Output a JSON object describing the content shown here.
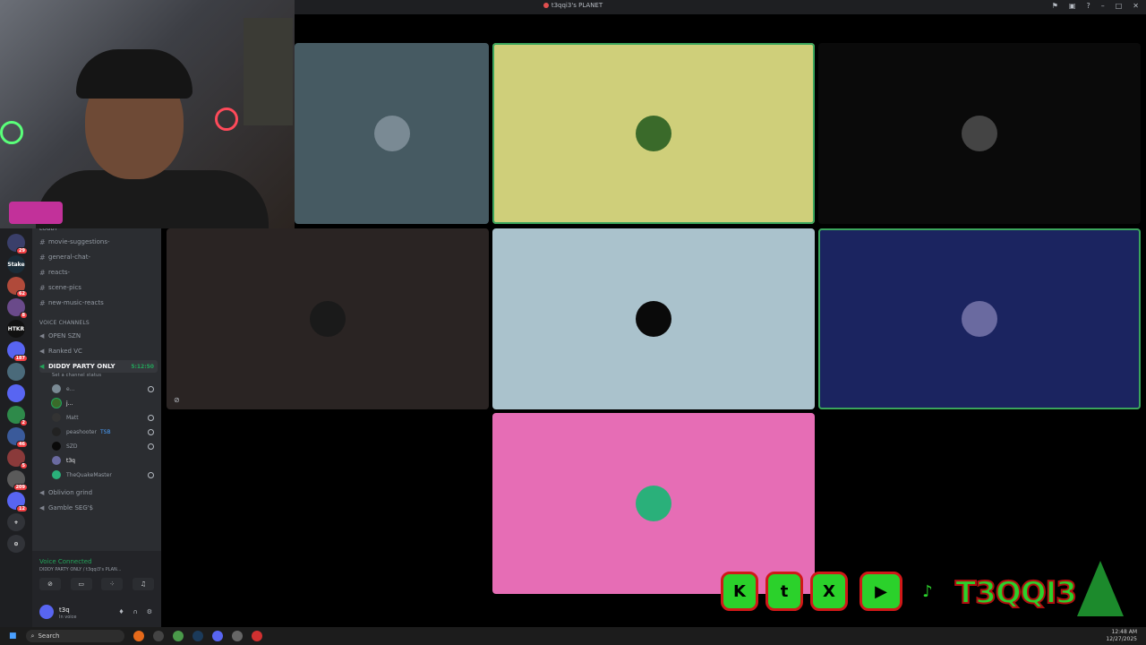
{
  "window": {
    "title": "t3qqi3's PLANET"
  },
  "server_icons": [
    {
      "label": "",
      "badge": "29",
      "color": "#3a3f6a"
    },
    {
      "label": "Stake",
      "badge": "",
      "color": "#1a2c38"
    },
    {
      "label": "",
      "badge": "62",
      "color": "#b04a3a"
    },
    {
      "label": "",
      "badge": "8",
      "color": "#6a4a8a"
    },
    {
      "label": "HTKR",
      "badge": "",
      "color": "#111111"
    },
    {
      "label": "",
      "badge": "187",
      "color": "#5865f2"
    },
    {
      "label": "",
      "badge": "",
      "color": "#4a6a7a"
    },
    {
      "label": "",
      "badge": "",
      "color": "#5865f2"
    },
    {
      "label": "",
      "badge": "2",
      "color": "#2e8a4a"
    },
    {
      "label": "",
      "badge": "46",
      "color": "#3a5a9a"
    },
    {
      "label": "",
      "badge": "5",
      "color": "#8a3a3a"
    },
    {
      "label": "",
      "badge": "209",
      "color": "#5a5a5a"
    },
    {
      "label": "",
      "badge": "12",
      "color": "#5865f2"
    },
    {
      "label": "+",
      "badge": "",
      "color": "#313338"
    },
    {
      "label": "⊙",
      "badge": "",
      "color": "#313338"
    }
  ],
  "channels": {
    "lobby_label": "LOBBY",
    "text": [
      "movie-suggestions-",
      "general-chat-",
      "reacts-",
      "scene-pics",
      "new-music-reacts"
    ],
    "voice_category": "VOICE CHANNELS",
    "voice": [
      "OPEN SZN",
      "Ranked VC"
    ],
    "active_voice": {
      "name": "DIDDY PARTY ONLY",
      "timer": "5:12:50",
      "status": "Set a channel status"
    },
    "voice_users": [
      "e...",
      "j...",
      "Matt",
      "peashooter",
      "SZD",
      "t3q",
      "TheQuakeMaster"
    ],
    "voice_user_tag": "TSB",
    "more_voice": [
      "Oblivion grind",
      "Gamble SEG'$"
    ]
  },
  "voice_panel": {
    "status": "Voice Connected",
    "location": "DIDDY PARTY ONLY / t3qqi3's PLAN..."
  },
  "user_panel": {
    "name": "t3q",
    "status": "In voice"
  },
  "tiles": [
    {
      "bg": "#465a62",
      "speaking": false,
      "avatar": "#7a8a94"
    },
    {
      "bg": "#cfcf7a",
      "speaking": true,
      "avatar": "#3a6a2a"
    },
    {
      "bg": "#0a0a0a",
      "speaking": false,
      "avatar": "#444444"
    },
    {
      "bg": "#2a2423",
      "speaking": false,
      "avatar": "#1a1a1a"
    },
    {
      "bg": "#aac2cc",
      "speaking": false,
      "avatar": "#0a0a0a"
    },
    {
      "bg": "#1b2460",
      "speaking": true,
      "avatar": "#6a6aa0"
    },
    {
      "bg": "#e66db5",
      "speaking": false,
      "avatar": "#2ab07a"
    }
  ],
  "socials": {
    "buttons": [
      "K",
      "t",
      "X",
      "▶",
      "♪"
    ],
    "handle": "T3QQI3"
  },
  "taskbar": {
    "search_placeholder": "Search",
    "time": "12:48 AM",
    "date": "12/27/2025"
  }
}
